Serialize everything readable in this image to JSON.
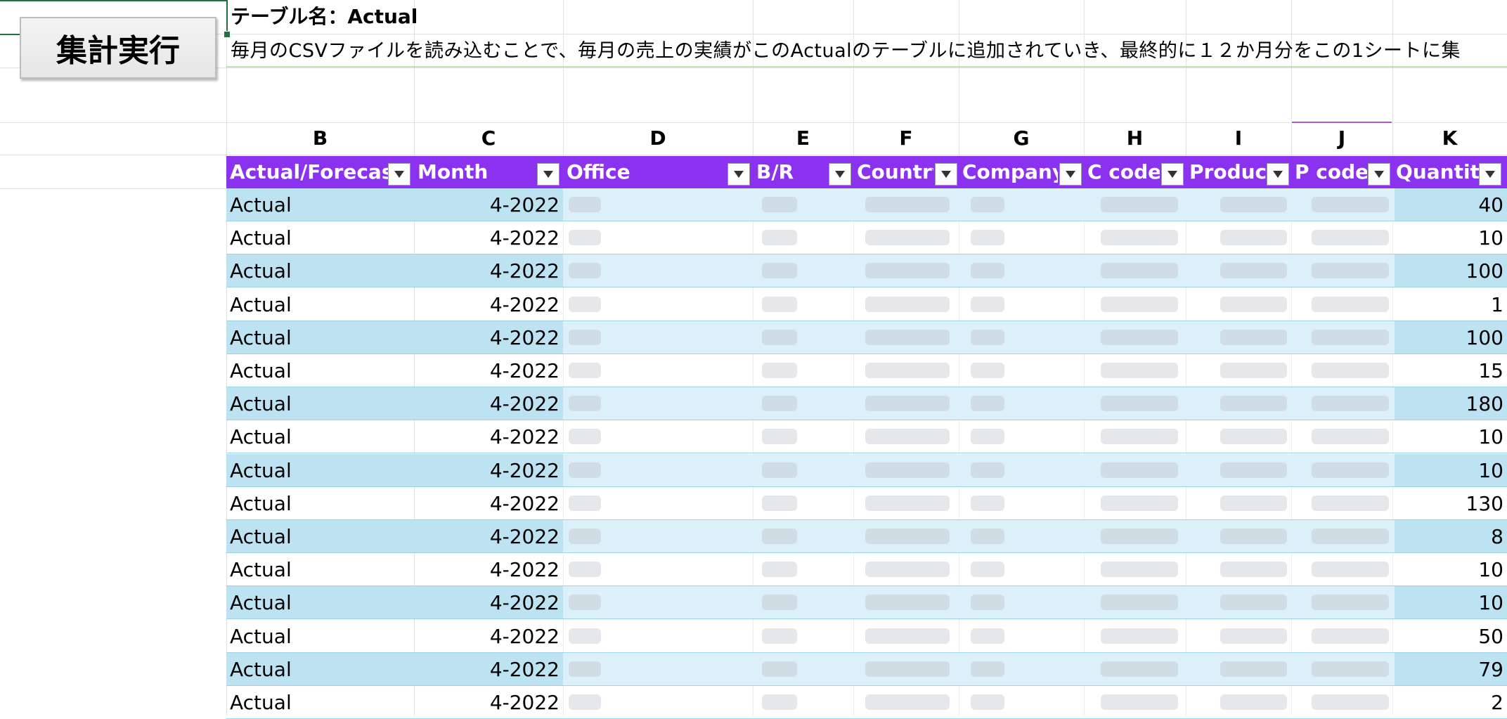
{
  "macro_button": {
    "label": "集計実行"
  },
  "table_name": "テーブル名：Actual",
  "description": "毎月のCSVファイルを読み込むことで、毎月の売上の実績がこのActualのテーブルに追加されていき、最終的に１２か月分をこの1シートに集",
  "column_letters": [
    "B",
    "C",
    "D",
    "E",
    "F",
    "G",
    "H",
    "I",
    "J",
    "K"
  ],
  "table": {
    "headers": [
      "Actual/Forecast",
      "Month",
      "Office",
      "B/R",
      "Country",
      "Company",
      "C code",
      "Product",
      "P code",
      "Quantity"
    ],
    "rows": [
      {
        "type": "Actual",
        "month": "4-2022",
        "quantity": "40"
      },
      {
        "type": "Actual",
        "month": "4-2022",
        "quantity": "10"
      },
      {
        "type": "Actual",
        "month": "4-2022",
        "quantity": "100"
      },
      {
        "type": "Actual",
        "month": "4-2022",
        "quantity": "1"
      },
      {
        "type": "Actual",
        "month": "4-2022",
        "quantity": "100"
      },
      {
        "type": "Actual",
        "month": "4-2022",
        "quantity": "15"
      },
      {
        "type": "Actual",
        "month": "4-2022",
        "quantity": "180"
      },
      {
        "type": "Actual",
        "month": "4-2022",
        "quantity": "10"
      },
      {
        "type": "Actual",
        "month": "4-2022",
        "quantity": "10"
      },
      {
        "type": "Actual",
        "month": "4-2022",
        "quantity": "130"
      },
      {
        "type": "Actual",
        "month": "4-2022",
        "quantity": "8"
      },
      {
        "type": "Actual",
        "month": "4-2022",
        "quantity": "10"
      },
      {
        "type": "Actual",
        "month": "4-2022",
        "quantity": "10"
      },
      {
        "type": "Actual",
        "month": "4-2022",
        "quantity": "50"
      },
      {
        "type": "Actual",
        "month": "4-2022",
        "quantity": "79"
      },
      {
        "type": "Actual",
        "month": "4-2022",
        "quantity": "2"
      }
    ]
  },
  "colors": {
    "header_bg": "#8a32f0",
    "band_bg": "#bde3f2",
    "accent_green": "#1e7145"
  },
  "icons": {
    "filter": "filter-dropdown-icon"
  }
}
